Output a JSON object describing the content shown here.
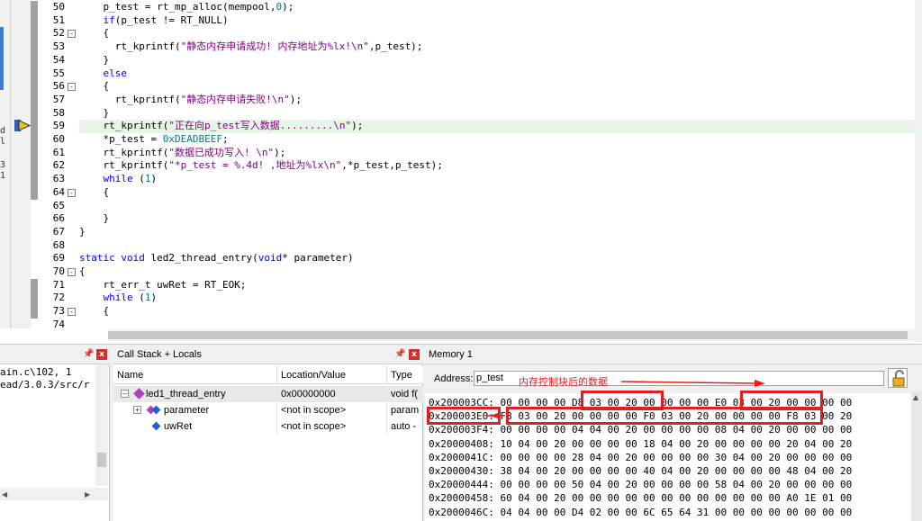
{
  "editor": {
    "lines": [
      {
        "num": "50",
        "tokens": [
          [
            "plain",
            "    p_test = rt_mp_alloc(mempool,"
          ],
          [
            "num",
            "0"
          ],
          [
            "plain",
            ");"
          ]
        ]
      },
      {
        "num": "51",
        "tokens": [
          [
            "kw",
            "    if"
          ],
          [
            "plain",
            "(p_test != RT_NULL)"
          ]
        ]
      },
      {
        "num": "52",
        "tokens": [
          [
            "plain",
            "    {"
          ]
        ]
      },
      {
        "num": "53",
        "tokens": [
          [
            "plain",
            "      rt_kprintf("
          ],
          [
            "str",
            "\"静态内存申请成功! 内存地址为%lx!\\n\""
          ],
          [
            "plain",
            ",p_test);"
          ]
        ]
      },
      {
        "num": "54",
        "tokens": [
          [
            "plain",
            "    }"
          ]
        ]
      },
      {
        "num": "55",
        "tokens": [
          [
            "kw",
            "    else"
          ]
        ]
      },
      {
        "num": "56",
        "tokens": [
          [
            "plain",
            "    {"
          ]
        ]
      },
      {
        "num": "57",
        "tokens": [
          [
            "plain",
            "      rt_kprintf("
          ],
          [
            "str",
            "\"静态内存申请失败!\\n\""
          ],
          [
            "plain",
            ");"
          ]
        ]
      },
      {
        "num": "58",
        "tokens": [
          [
            "plain",
            "    }"
          ]
        ]
      },
      {
        "num": "59",
        "tokens": [
          [
            "plain",
            "    rt_kprintf("
          ],
          [
            "str",
            "\"正在向p_test写入数据.........\\n\""
          ],
          [
            "plain",
            ");"
          ]
        ]
      },
      {
        "num": "60",
        "tokens": [
          [
            "plain",
            "    *p_test = "
          ],
          [
            "num",
            "0xDEADBEEF"
          ],
          [
            "plain",
            ";"
          ]
        ]
      },
      {
        "num": "61",
        "tokens": [
          [
            "plain",
            "    rt_kprintf("
          ],
          [
            "str",
            "\"数据已成功写入! \\n\""
          ],
          [
            "plain",
            ");"
          ]
        ]
      },
      {
        "num": "62",
        "tokens": [
          [
            "plain",
            "    rt_kprintf("
          ],
          [
            "str",
            "\"*p_test = %.4d! ,地址为%lx\\n\""
          ],
          [
            "plain",
            ",*p_test,p_test);"
          ]
        ]
      },
      {
        "num": "63",
        "tokens": [
          [
            "kw",
            "    while"
          ],
          [
            "plain",
            " ("
          ],
          [
            "num",
            "1"
          ],
          [
            "plain",
            ")"
          ]
        ]
      },
      {
        "num": "64",
        "tokens": [
          [
            "plain",
            "    {"
          ]
        ]
      },
      {
        "num": "65",
        "tokens": [
          [
            "plain",
            ""
          ]
        ]
      },
      {
        "num": "66",
        "tokens": [
          [
            "plain",
            "    }"
          ]
        ]
      },
      {
        "num": "67",
        "tokens": [
          [
            "plain",
            "}"
          ]
        ]
      },
      {
        "num": "68",
        "tokens": [
          [
            "plain",
            ""
          ]
        ]
      },
      {
        "num": "69",
        "tokens": [
          [
            "kw",
            "static void"
          ],
          [
            "plain",
            " led2_thread_entry("
          ],
          [
            "kw",
            "void"
          ],
          [
            "plain",
            "* parameter)"
          ]
        ]
      },
      {
        "num": "70",
        "tokens": [
          [
            "plain",
            "{"
          ]
        ]
      },
      {
        "num": "71",
        "tokens": [
          [
            "plain",
            "    rt_err_t uwRet = RT_EOK;"
          ]
        ]
      },
      {
        "num": "72",
        "tokens": [
          [
            "kw",
            "    while"
          ],
          [
            "plain",
            " ("
          ],
          [
            "num",
            "1"
          ],
          [
            "plain",
            ")"
          ]
        ]
      },
      {
        "num": "73",
        "tokens": [
          [
            "plain",
            "    {"
          ]
        ]
      },
      {
        "num": "74",
        "tokens": [
          [
            "plain",
            ""
          ]
        ]
      }
    ],
    "current_line": "59",
    "left_strip_text": [
      "d",
      "l",
      "",
      "3",
      "1"
    ]
  },
  "build_output": {
    "lines": [
      "ain.c\\102, 1",
      "ead/3.0.3/src/r"
    ]
  },
  "callstack": {
    "title": "Call Stack + Locals",
    "columns": [
      "Name",
      "Location/Value",
      "Type"
    ],
    "rows": [
      {
        "name": "led1_thread_entry",
        "value": "0x00000000",
        "type": "void f("
      },
      {
        "name": "parameter",
        "value": "<not in scope>",
        "type": "param"
      },
      {
        "name": "uwRet",
        "value": "<not in scope>",
        "type": "auto -"
      }
    ]
  },
  "memory": {
    "title": "Memory 1",
    "address_label": "Address:",
    "address_value": "p_test",
    "annotation": "内存控制块后的数据",
    "rows": [
      "0x200003CC: 00 00 00 00 D8 03 00 20 00 00 00 00 E0 03 00 20 00 00 00 00",
      "0x200003E0: F8 03 00 20 00 00 00 00 F0 03 00 20 00 00 00 00 F8 03 00 20",
      "0x200003F4: 00 00 00 00 04 04 00 20 00 00 00 00 08 04 00 20 00 00 00 00",
      "0x20000408: 10 04 00 20 00 00 00 00 18 04 00 20 00 00 00 00 20 04 00 20",
      "0x2000041C: 00 00 00 00 28 04 00 20 00 00 00 00 30 04 00 20 00 00 00 00",
      "0x20000430: 38 04 00 20 00 00 00 00 40 04 00 20 00 00 00 00 48 04 00 20",
      "0x20000444: 00 00 00 00 50 04 00 20 00 00 00 00 58 04 00 20 00 00 00 00",
      "0x20000458: 60 04 00 20 00 00 00 00 00 00 00 00 00 00 00 00 A0 1E 01 00",
      "0x2000046C: 04 04 00 00 D4 02 00 00 6C 65 64 31 00 00 00 00 00 00 00 00"
    ]
  },
  "colors": {
    "annotation_red": "#e02020",
    "highlight_line": "#e6f5e6",
    "keyword": "#0000ff",
    "string": "#800080"
  }
}
